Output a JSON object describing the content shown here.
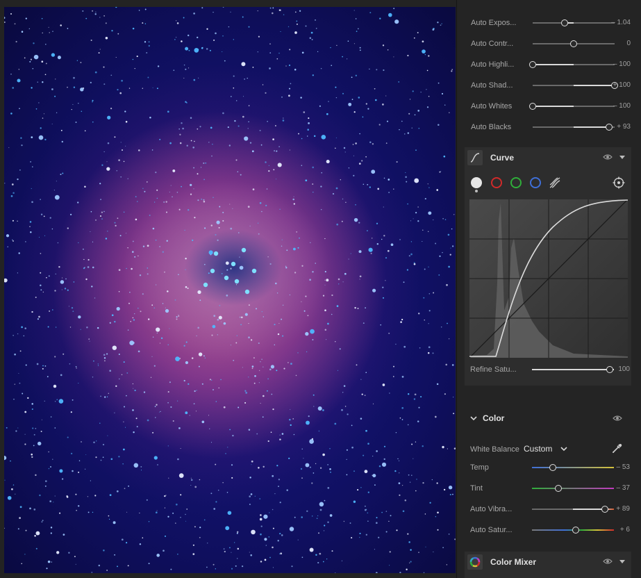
{
  "photo": {
    "subject": "rosette-nebula"
  },
  "light": {
    "sliders": [
      {
        "label": "Auto Expos...",
        "value": "– 1.04",
        "position": 0.39,
        "fill_start": 0.39,
        "fill_end": 0.5
      },
      {
        "label": "Auto Contr...",
        "value": "0",
        "position": 0.5,
        "fill_start": 0.5,
        "fill_end": 0.5
      },
      {
        "label": "Auto Highli...",
        "value": "– 100",
        "position": 0.0,
        "fill_start": 0.0,
        "fill_end": 0.5
      },
      {
        "label": "Auto Shad...",
        "value": "+ 100",
        "position": 1.0,
        "fill_start": 0.5,
        "fill_end": 1.0
      },
      {
        "label": "Auto Whites",
        "value": "– 100",
        "position": 0.0,
        "fill_start": 0.0,
        "fill_end": 0.5
      },
      {
        "label": "Auto Blacks",
        "value": "+ 93",
        "position": 0.93,
        "fill_start": 0.5,
        "fill_end": 0.93
      }
    ]
  },
  "curve": {
    "title": "Curve",
    "icon": "tone-curve-icon",
    "channels": [
      {
        "name": "rgb-channel-icon",
        "color": "#dcdcdc"
      },
      {
        "name": "red-channel-icon",
        "color": "#d02a2a"
      },
      {
        "name": "green-channel-icon",
        "color": "#2fae3a"
      },
      {
        "name": "blue-channel-icon",
        "color": "#3f6fd8"
      },
      {
        "name": "parametric-icon",
        "color": "#bdbdbd"
      }
    ],
    "refine": {
      "label": "Refine Satu...",
      "value": "100",
      "position": 1.0
    }
  },
  "color": {
    "title": "Color",
    "white_balance_label": "White Balance",
    "white_balance_value": "Custom",
    "sliders": [
      {
        "label": "Temp",
        "value": "– 53",
        "position": 0.25,
        "gradient": "linear-gradient(90deg,#3f6fd8,#d6c23a)"
      },
      {
        "label": "Tint",
        "value": "– 37",
        "position": 0.32,
        "gradient": "linear-gradient(90deg,#2fae3a,#c23ac0)"
      },
      {
        "label": "Auto Vibra...",
        "value": "+ 89",
        "position": 0.89,
        "gradient": "linear-gradient(90deg,#6a6a6a,#6a6a6a 50%,#d9d9d9 50%,#d9d9d9 88%,#d0552a 100%)"
      },
      {
        "label": "Auto Satur...",
        "value": "+ 6",
        "position": 0.53,
        "gradient": "linear-gradient(90deg,#7a7a7a,#3f6fd8 40%,#2fae3a 60%,#d6c23a 80%,#d02a2a)"
      }
    ]
  },
  "color_mixer": {
    "title": "Color Mixer",
    "icon": "color-wheel-icon"
  }
}
